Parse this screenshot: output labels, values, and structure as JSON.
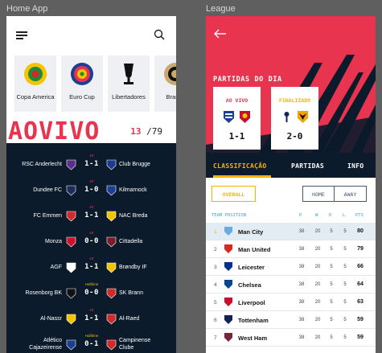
{
  "frames": {
    "home_label": "Home App",
    "league_label": "League"
  },
  "home": {
    "competitions": [
      {
        "name": "Copa America",
        "icon": "copa-america-logo-icon"
      },
      {
        "name": "Euro Cup",
        "icon": "euro-cup-logo-icon"
      },
      {
        "name": "Libertadores",
        "icon": "libertadores-trophy-icon"
      },
      {
        "name": "Brasile",
        "icon": "brasileirao-logo-icon"
      }
    ],
    "live_title": "AOVIVO",
    "live_count": "13",
    "total_count": "/79",
    "matches": [
      {
        "home": "RSC Anderlecht",
        "away": "Club Brugge",
        "minute": "45'",
        "score": "1-1",
        "home_color": "#5b2d8f",
        "away_color": "#1a3b8f"
      },
      {
        "home": "Dundee FC",
        "away": "Kilmarnock",
        "minute": "45'",
        "score": "1-0",
        "home_color": "#1c2c5b",
        "away_color": "#1c3f94"
      },
      {
        "home": "FC Emmen",
        "away": "NAC Breda",
        "minute": "45'",
        "score": "1-1",
        "home_color": "#d22a2a",
        "away_color": "#f5c400"
      },
      {
        "home": "Monza",
        "away": "Cittadella",
        "minute": "45'",
        "score": "0-0",
        "home_color": "#d0112b",
        "away_color": "#7a1c2a"
      },
      {
        "home": "AGF",
        "away": "Brøndby IF",
        "minute": "45'",
        "score": "1-1",
        "home_color": "#ffffff",
        "away_color": "#f5c400"
      },
      {
        "home": "Rosenborg BK",
        "away": "SK Brann",
        "minute": "Halftime",
        "score": "0-0",
        "home_color": "#111111",
        "away_color": "#d22a2a"
      },
      {
        "home": "Al-Nassr",
        "away": "Al-Raed",
        "minute": "45'",
        "score": "1-1",
        "home_color": "#f5c400",
        "away_color": "#d22a2a"
      },
      {
        "home": "Atlético Cajazeirense",
        "away": "Campinense Clube",
        "minute": "Halftime",
        "score": "0-1",
        "home_color": "#1c3f94",
        "away_color": "#d22a2a"
      }
    ]
  },
  "league": {
    "section_title": "PARTIDAS DO DIA",
    "cards": [
      {
        "tag": "AO VIVO",
        "tag_color": "#e8344e",
        "score": "1-1",
        "home_icon": "west-brom-crest-icon",
        "away_icon": "liverpool-crest-icon",
        "home_color": "#1c3f94",
        "away_color": "#c8102e"
      },
      {
        "tag": "FINALIZADO",
        "tag_color": "#f5b400",
        "score": "2-0",
        "home_icon": "tottenham-crest-icon",
        "away_icon": "wolves-crest-icon",
        "home_color": "#132257",
        "away_color": "#f5a300"
      }
    ],
    "tabs": [
      "CLASSIFICAÇÃO",
      "PARTIDAS",
      "INFO"
    ],
    "filters": {
      "overall": "OVERALL",
      "home": "HOME",
      "away": "AWAY"
    },
    "columns": {
      "team": "TEAM POSITION",
      "p": "P",
      "w": "W",
      "d": "D",
      "l": "L",
      "pts": "PTS"
    },
    "rows": [
      {
        "pos": "1",
        "team": "Man City",
        "p": "38",
        "w": "20",
        "d": "5",
        "l": "5",
        "pts": "80",
        "color": "#6cabdd"
      },
      {
        "pos": "2",
        "team": "Man United",
        "p": "38",
        "w": "20",
        "d": "5",
        "l": "5",
        "pts": "79",
        "color": "#da291c"
      },
      {
        "pos": "3",
        "team": "Leicester",
        "p": "38",
        "w": "20",
        "d": "5",
        "l": "5",
        "pts": "66",
        "color": "#003090"
      },
      {
        "pos": "4",
        "team": "Chelsea",
        "p": "38",
        "w": "20",
        "d": "5",
        "l": "5",
        "pts": "64",
        "color": "#034694"
      },
      {
        "pos": "5",
        "team": "Liverpool",
        "p": "38",
        "w": "20",
        "d": "5",
        "l": "5",
        "pts": "63",
        "color": "#c8102e"
      },
      {
        "pos": "6",
        "team": "Tottenham",
        "p": "38",
        "w": "20",
        "d": "5",
        "l": "5",
        "pts": "59",
        "color": "#132257"
      },
      {
        "pos": "7",
        "team": "West Ham",
        "p": "38",
        "w": "20",
        "d": "5",
        "l": "5",
        "pts": "59",
        "color": "#7a263a"
      }
    ]
  }
}
